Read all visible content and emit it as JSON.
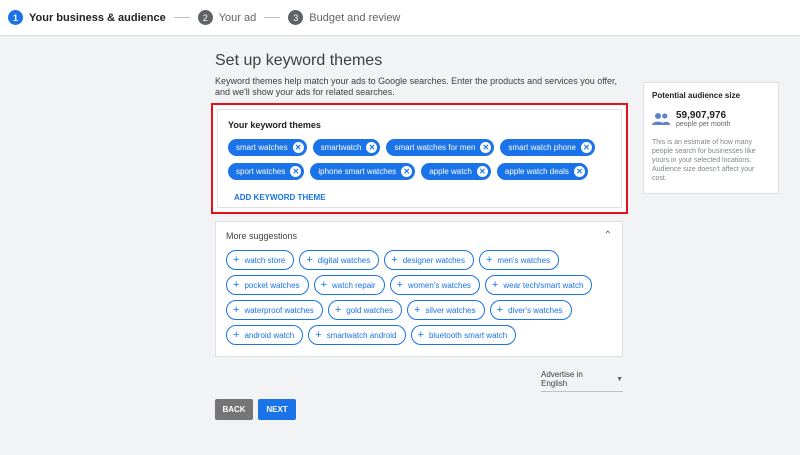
{
  "steps": [
    {
      "num": "1",
      "label": "Your business & audience"
    },
    {
      "num": "2",
      "label": "Your ad"
    },
    {
      "num": "3",
      "label": "Budget and review"
    }
  ],
  "title": "Set up keyword themes",
  "description": "Keyword themes help match your ads to Google searches. Enter the products and services you offer, and we'll show your ads for related searches.",
  "keywords": {
    "heading": "Your keyword themes",
    "rows": [
      [
        "smart watches",
        "smartwatch",
        "smart watches for men",
        "smart watch phone"
      ],
      [
        "sport watches",
        "iphone smart watches",
        "apple watch",
        "apple watch deals"
      ]
    ],
    "add_label": "ADD KEYWORD THEME"
  },
  "suggestions": {
    "heading": "More suggestions",
    "rows": [
      [
        "watch store",
        "digital watches",
        "designer watches",
        "men's watches"
      ],
      [
        "pocket watches",
        "watch repair",
        "women's watches",
        "wear tech/smart watch"
      ],
      [
        "waterproof watches",
        "gold watches",
        "silver watches",
        "diver's watches"
      ],
      [
        "android watch",
        "smartwatch android",
        "bluetooth smart watch"
      ]
    ]
  },
  "audience": {
    "title": "Potential audience size",
    "number": "59,907,976",
    "unit": "people per month",
    "note": "This is an estimate of how many people search for businesses like yours in your selected locations. Audience size doesn't affect your cost."
  },
  "language": "Advertise in English",
  "buttons": {
    "back": "BACK",
    "next": "NEXT"
  },
  "icons": {
    "remove": "close-icon",
    "add": "plus-icon",
    "collapse": "chevron-up-icon",
    "audience": "people-icon",
    "dropdown": "caret-down-icon"
  },
  "colors": {
    "accent": "#1a73e8",
    "highlight_border": "#e8101a",
    "back_button": "#757575"
  }
}
